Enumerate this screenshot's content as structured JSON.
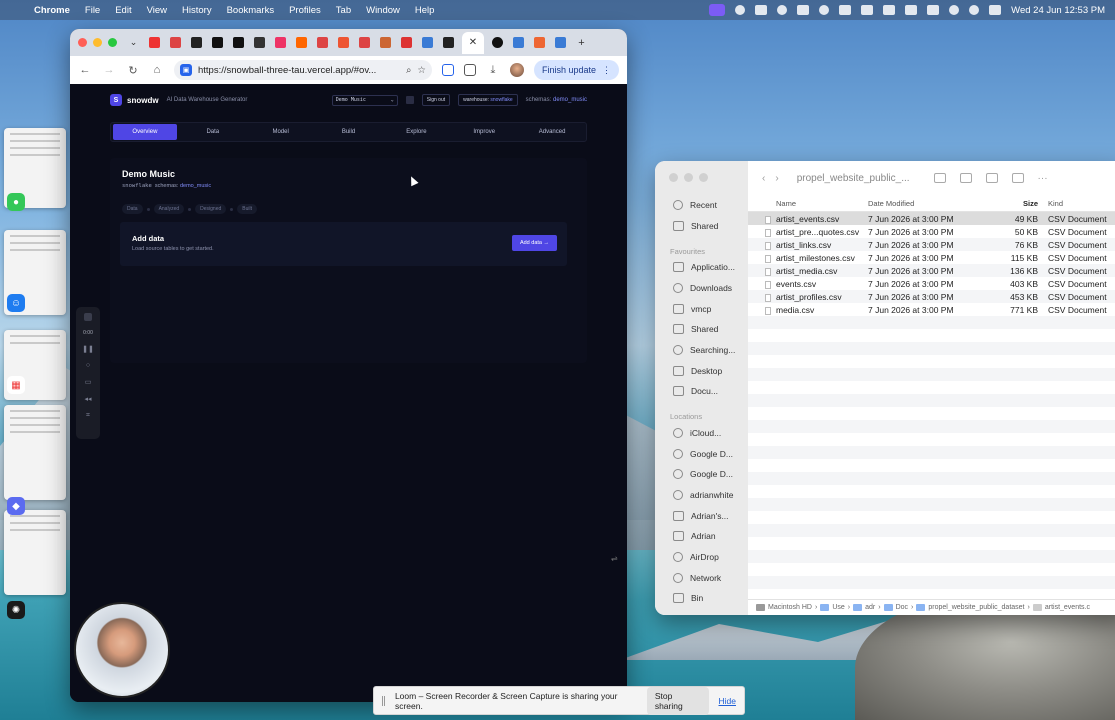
{
  "menubar": {
    "app": "Chrome",
    "items": [
      "File",
      "Edit",
      "View",
      "History",
      "Bookmarks",
      "Profiles",
      "Tab",
      "Window",
      "Help"
    ],
    "clock": "Wed 24 Jun  12:53 PM"
  },
  "browser": {
    "url": "https://snowball-three-tau.vercel.app/#ov...",
    "update_label": "Finish update"
  },
  "app": {
    "logo_letter": "S",
    "brand": "snowdw",
    "tagline": "AI Data Warehouse Generator",
    "db_select": "Demo Music",
    "sign_out": "Sign out",
    "warehouse_label": "warehouse:",
    "warehouse_value": "snowflake",
    "schemas_label": "schemas:",
    "schemas_value": "demo_music",
    "tabs": [
      "Overview",
      "Data",
      "Model",
      "Build",
      "Explore",
      "Improve",
      "Advanced"
    ],
    "project_title": "Demo Music",
    "project_sub_db": "snowflake",
    "project_sub_schema_label": "schemas:",
    "project_sub_schema": "demo_music",
    "steps": [
      "Data",
      "Analyzed",
      "Designed",
      "Built"
    ],
    "add_data_title": "Add data",
    "add_data_sub": "Load source tables to get started.",
    "add_data_button": "Add data →"
  },
  "loom_tools": {
    "timer": "0:00"
  },
  "finder": {
    "title": "propel_website_public_...",
    "sidebar": {
      "top": [
        "Recent",
        "Shared"
      ],
      "favourites_header": "Favourites",
      "favourites": [
        "Applicatio...",
        "Downloads",
        "vmcp",
        "Shared",
        "Searching...",
        "Desktop",
        "Docu..."
      ],
      "locations_header": "Locations",
      "locations": [
        "iCloud...",
        "Google D...",
        "Google D...",
        "adrianwhite",
        "Adrian's...",
        "Adrian",
        "AirDrop",
        "Network",
        "Bin"
      ]
    },
    "columns": [
      "Name",
      "Date Modified",
      "Size",
      "Kind"
    ],
    "files": [
      {
        "name": "artist_events.csv",
        "date": "7 Jun 2026 at 3:00 PM",
        "size": "49 KB",
        "kind": "CSV Document"
      },
      {
        "name": "artist_pre...quotes.csv",
        "date": "7 Jun 2026 at 3:00 PM",
        "size": "50 KB",
        "kind": "CSV Document"
      },
      {
        "name": "artist_links.csv",
        "date": "7 Jun 2026 at 3:00 PM",
        "size": "76 KB",
        "kind": "CSV Document"
      },
      {
        "name": "artist_milestones.csv",
        "date": "7 Jun 2026 at 3:00 PM",
        "size": "115 KB",
        "kind": "CSV Document"
      },
      {
        "name": "artist_media.csv",
        "date": "7 Jun 2026 at 3:00 PM",
        "size": "136 KB",
        "kind": "CSV Document"
      },
      {
        "name": "events.csv",
        "date": "7 Jun 2026 at 3:00 PM",
        "size": "403 KB",
        "kind": "CSV Document"
      },
      {
        "name": "artist_profiles.csv",
        "date": "7 Jun 2026 at 3:00 PM",
        "size": "453 KB",
        "kind": "CSV Document"
      },
      {
        "name": "media.csv",
        "date": "7 Jun 2026 at 3:00 PM",
        "size": "771 KB",
        "kind": "CSV Document"
      }
    ],
    "path": [
      "Macintosh HD",
      "Use",
      "adr",
      "Doc",
      "propel_website_public_dataset",
      "artist_events.c"
    ]
  },
  "share_banner": {
    "message": "Loom – Screen Recorder & Screen Capture is sharing your screen.",
    "stop": "Stop sharing",
    "hide": "Hide"
  }
}
